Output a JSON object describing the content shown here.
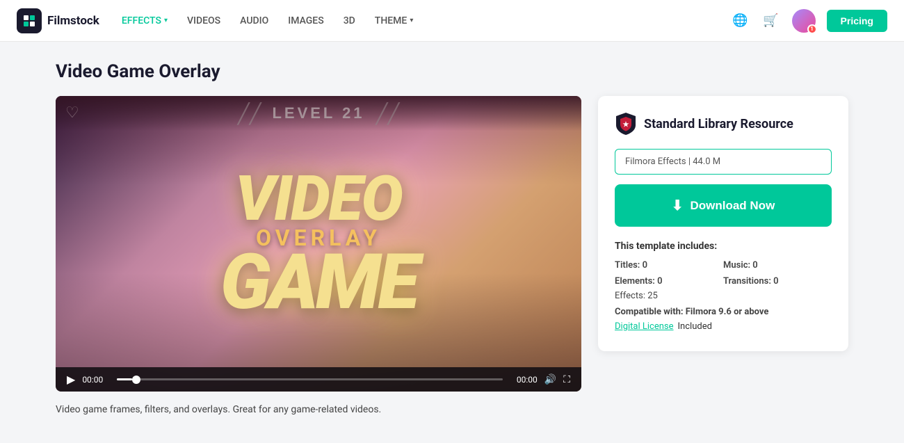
{
  "brand": {
    "logo_text": "Filmstock",
    "logo_icon": "F"
  },
  "nav": {
    "links": [
      {
        "label": "EFFECTS",
        "active": true,
        "has_arrow": true
      },
      {
        "label": "VIDEOS",
        "active": false,
        "has_arrow": false
      },
      {
        "label": "AUDIO",
        "active": false,
        "has_arrow": false
      },
      {
        "label": "IMAGES",
        "active": false,
        "has_arrow": false
      },
      {
        "label": "3D",
        "active": false,
        "has_arrow": false
      },
      {
        "label": "THEME",
        "active": false,
        "has_arrow": true
      }
    ],
    "pricing_label": "Pricing"
  },
  "page": {
    "title": "Video Game Overlay",
    "description": "Video game frames, filters, and overlays. Great for any game-related videos."
  },
  "video": {
    "level_text": "LEVEL 21",
    "main_line1": "VIDEO",
    "main_line2": "OVERLAY",
    "main_line3": "GAME",
    "time_current": "00:00",
    "time_end": "00:00"
  },
  "sidebar": {
    "resource_title": "Standard Library Resource",
    "file_info": "Filmora Effects | 44.0 M",
    "download_label": "Download Now",
    "template_includes_label": "This template includes:",
    "titles_label": "Titles:",
    "titles_value": "0",
    "music_label": "Music:",
    "music_value": "0",
    "elements_label": "Elements:",
    "elements_value": "0",
    "transitions_label": "Transitions:",
    "transitions_value": "0",
    "effects_label": "Effects:",
    "effects_value": "25",
    "compat_label": "Compatible with:",
    "compat_value": "Filmora 9.6 or above",
    "license_link": "Digital License",
    "license_text": "Included"
  }
}
